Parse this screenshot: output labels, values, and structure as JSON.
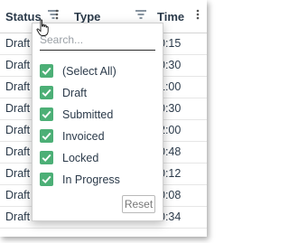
{
  "columns": {
    "status": "Status",
    "type": "Type",
    "time": "Time"
  },
  "rows": [
    {
      "status": "Draft",
      "time": "0:15"
    },
    {
      "status": "Draft",
      "time": "0:30"
    },
    {
      "status": "Draft",
      "time": "1:00"
    },
    {
      "status": "Draft",
      "time": "0:30"
    },
    {
      "status": "Draft",
      "time": "2:00"
    },
    {
      "status": "Draft",
      "time": "0:48"
    },
    {
      "status": "Draft",
      "time": "0:12"
    },
    {
      "status": "Draft",
      "time": "0:08"
    },
    {
      "status": "Draft",
      "time": "0:34"
    }
  ],
  "filter_popup": {
    "search_placeholder": "Search...",
    "options": [
      {
        "label": "(Select All)",
        "checked": true
      },
      {
        "label": "Draft",
        "checked": true
      },
      {
        "label": "Submitted",
        "checked": true
      },
      {
        "label": "Invoiced",
        "checked": true
      },
      {
        "label": "Locked",
        "checked": true
      },
      {
        "label": "In Progress",
        "checked": true
      }
    ],
    "reset_label": "Reset"
  },
  "colors": {
    "checkbox": "#4caf76",
    "text": "#2b3a4a"
  },
  "icons": {
    "filter": "filter-icon",
    "menu": "more-vertical-icon",
    "check": "check-icon",
    "cursor": "hand-pointer-cursor"
  }
}
